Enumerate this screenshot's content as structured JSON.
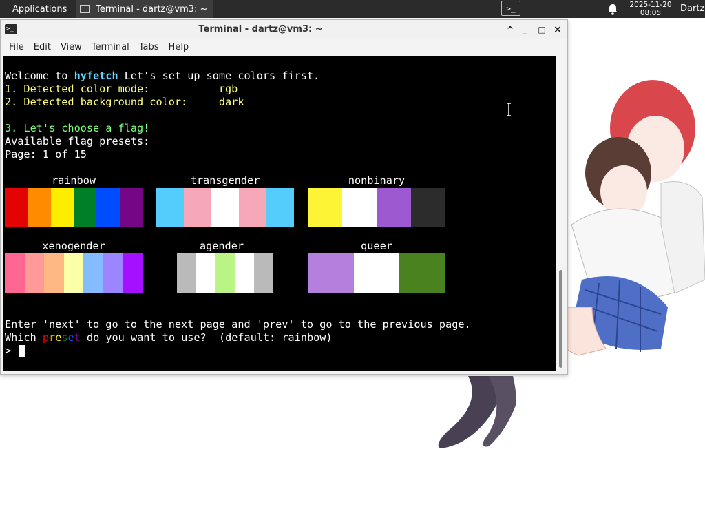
{
  "panel": {
    "applications_label": "Applications",
    "task_label": "Terminal - dartz@vm3: ~",
    "launcher_glyph": ">_",
    "clock_date": "2025-11-20",
    "clock_time": "08:05",
    "user_label": "Dartz",
    "bg_color": "#2b2b2b"
  },
  "window": {
    "title": "Terminal - dartz@vm3: ~",
    "icon": "terminal-icon",
    "controls": {
      "shade": "^",
      "minimize": "_",
      "maximize": "□",
      "close": "×"
    },
    "menu": [
      "File",
      "Edit",
      "View",
      "Terminal",
      "Tabs",
      "Help"
    ]
  },
  "terminal": {
    "bg_color": "#000000",
    "welcome_prefix": "Welcome to ",
    "welcome_brand": "hyfetch",
    "welcome_suffix": " Let's set up some colors first.",
    "line1": "1. Detected color mode:           rgb",
    "line2": "2. Detected background color:     dark",
    "line3": "3. Let's choose a flag!",
    "line4": "Available flag presets:",
    "line5": "Page: 1 of 15",
    "hint": "Enter 'next' to go to the next page and 'prev' to go to the previous page.",
    "question_prefix": "Which ",
    "question_word": "preset",
    "question_suffix": " do you want to use?  (default: rainbow)",
    "prompt": "> "
  },
  "flags": [
    {
      "name": "rainbow",
      "colors": [
        "#e40303",
        "#ff8c00",
        "#ffed00",
        "#008026",
        "#004dff",
        "#750787"
      ]
    },
    {
      "name": "transgender",
      "colors": [
        "#55cdfc",
        "#f7a8b8",
        "#ffffff",
        "#f7a8b8",
        "#55cdfc"
      ]
    },
    {
      "name": "nonbinary",
      "colors": [
        "#fcf434",
        "#ffffff",
        "#9c59d1",
        "#2c2c2c"
      ]
    },
    {
      "name": "xenogender",
      "colors": [
        "#ff6692",
        "#ff9a98",
        "#ffb883",
        "#fbffa8",
        "#85bcff",
        "#9d85ff",
        "#a510ff"
      ]
    },
    {
      "name": "agender",
      "colors": [
        "#bababa",
        "#ffffff",
        "#baf484",
        "#ffffff",
        "#bababa"
      ]
    },
    {
      "name": "queer",
      "colors": [
        "#b57fdd",
        "#ffffff",
        "#49821e"
      ]
    }
  ],
  "question_word_colors": [
    "#e40303",
    "#ff8c00",
    "#ffed00",
    "#008026",
    "#004dff",
    "#750787"
  ]
}
